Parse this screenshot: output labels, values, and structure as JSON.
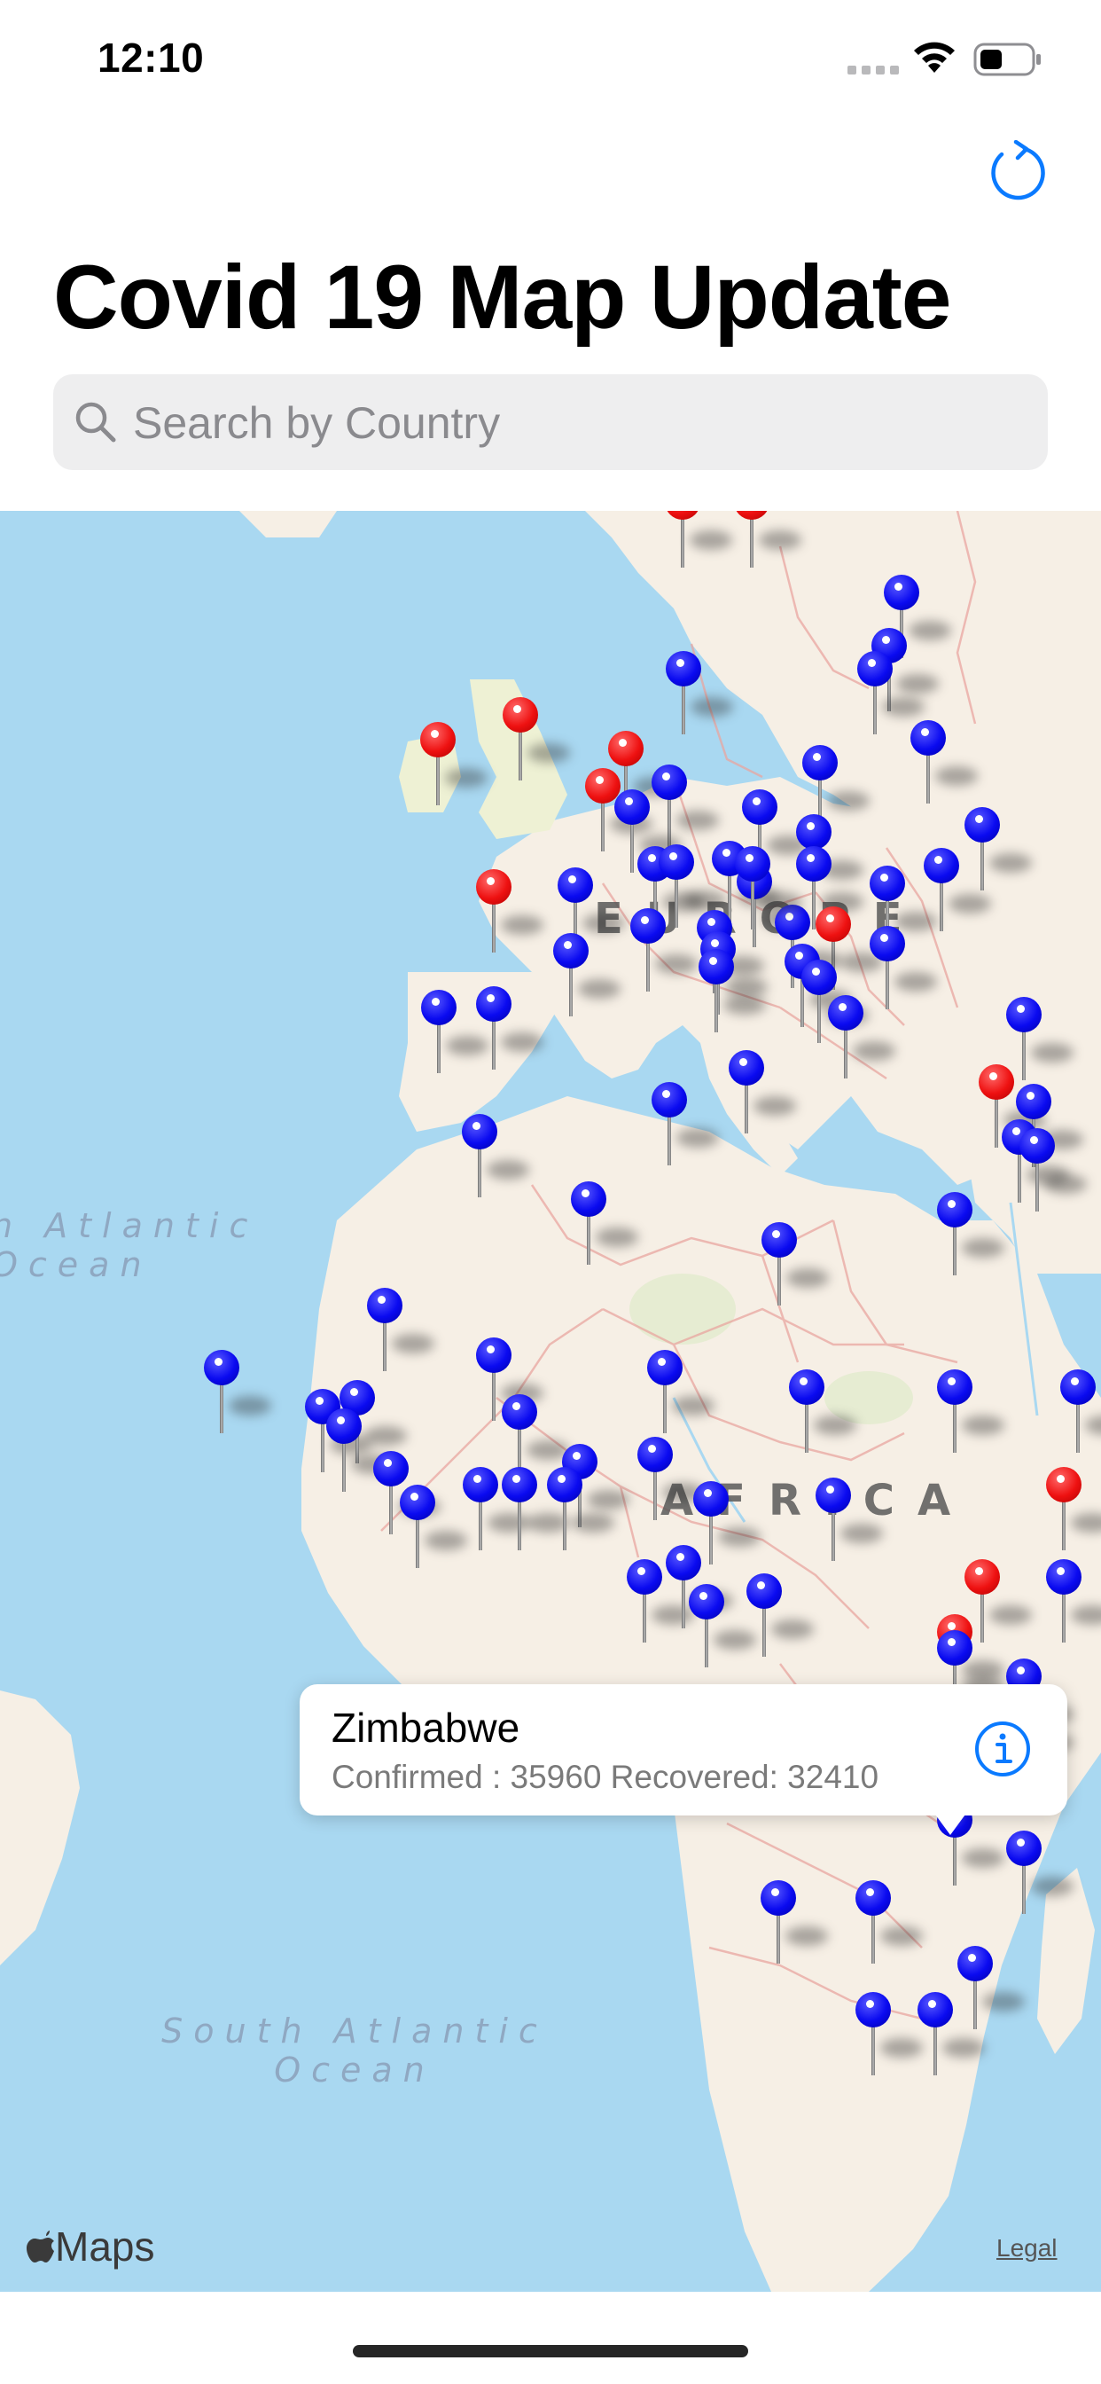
{
  "status_bar": {
    "time": "12:10"
  },
  "header": {
    "title": "Covid 19 Map Update",
    "refresh_icon": "refresh-icon"
  },
  "search": {
    "placeholder": "Search by Country",
    "value": ""
  },
  "map": {
    "provider_label": "Maps",
    "legal_label": "Legal",
    "ocean_labels": {
      "north_atlantic": "n Atlantic\nOcean",
      "south_atlantic": "South Atlantic\nOcean"
    },
    "region_labels": {
      "europe": "EUROPE",
      "africa": "AFRICA"
    },
    "pin_colors": {
      "blue": "#0a0af0",
      "red": "#ee1111"
    },
    "pins": [
      {
        "color": "red"
      },
      {
        "color": "red"
      },
      {
        "color": "blue"
      },
      {
        "color": "blue"
      },
      {
        "color": "blue"
      },
      {
        "color": "blue"
      },
      {
        "color": "red"
      },
      {
        "color": "red"
      },
      {
        "color": "red"
      },
      {
        "color": "red"
      },
      {
        "color": "blue"
      },
      {
        "color": "blue"
      },
      {
        "color": "blue"
      },
      {
        "color": "blue"
      },
      {
        "color": "blue"
      },
      {
        "color": "blue"
      },
      {
        "color": "blue"
      },
      {
        "color": "blue"
      },
      {
        "color": "blue"
      },
      {
        "color": "blue"
      },
      {
        "color": "blue"
      },
      {
        "color": "blue"
      },
      {
        "color": "blue"
      },
      {
        "color": "red"
      },
      {
        "color": "blue"
      },
      {
        "color": "blue"
      },
      {
        "color": "blue"
      },
      {
        "color": "blue"
      },
      {
        "color": "blue"
      },
      {
        "color": "blue"
      },
      {
        "color": "red"
      },
      {
        "color": "blue"
      },
      {
        "color": "blue"
      },
      {
        "color": "blue"
      },
      {
        "color": "blue"
      },
      {
        "color": "blue"
      },
      {
        "color": "blue"
      },
      {
        "color": "blue"
      },
      {
        "color": "blue"
      },
      {
        "color": "blue"
      },
      {
        "color": "blue"
      },
      {
        "color": "red"
      },
      {
        "color": "blue"
      },
      {
        "color": "blue"
      },
      {
        "color": "blue"
      },
      {
        "color": "blue"
      },
      {
        "color": "blue"
      },
      {
        "color": "blue"
      },
      {
        "color": "blue"
      },
      {
        "color": "blue"
      },
      {
        "color": "blue"
      },
      {
        "color": "blue"
      },
      {
        "color": "blue"
      },
      {
        "color": "blue"
      },
      {
        "color": "blue"
      },
      {
        "color": "blue"
      },
      {
        "color": "blue"
      },
      {
        "color": "blue"
      },
      {
        "color": "blue"
      },
      {
        "color": "blue"
      },
      {
        "color": "blue"
      },
      {
        "color": "blue"
      },
      {
        "color": "blue"
      },
      {
        "color": "blue"
      },
      {
        "color": "blue"
      },
      {
        "color": "blue"
      },
      {
        "color": "blue"
      },
      {
        "color": "blue"
      },
      {
        "color": "blue"
      },
      {
        "color": "blue"
      },
      {
        "color": "red"
      },
      {
        "color": "blue"
      },
      {
        "color": "red"
      },
      {
        "color": "blue"
      },
      {
        "color": "red"
      },
      {
        "color": "blue"
      },
      {
        "color": "blue"
      },
      {
        "color": "blue"
      },
      {
        "color": "blue"
      },
      {
        "color": "blue"
      },
      {
        "color": "blue"
      },
      {
        "color": "red"
      },
      {
        "color": "blue"
      },
      {
        "color": "blue"
      },
      {
        "color": "blue"
      },
      {
        "color": "blue"
      },
      {
        "color": "blue"
      },
      {
        "color": "blue"
      },
      {
        "color": "blue"
      }
    ],
    "callout": {
      "title": "Zimbabwe",
      "subtitle": "Confirmed : 35960 Recovered: 32410",
      "info_icon": "info-icon"
    }
  }
}
